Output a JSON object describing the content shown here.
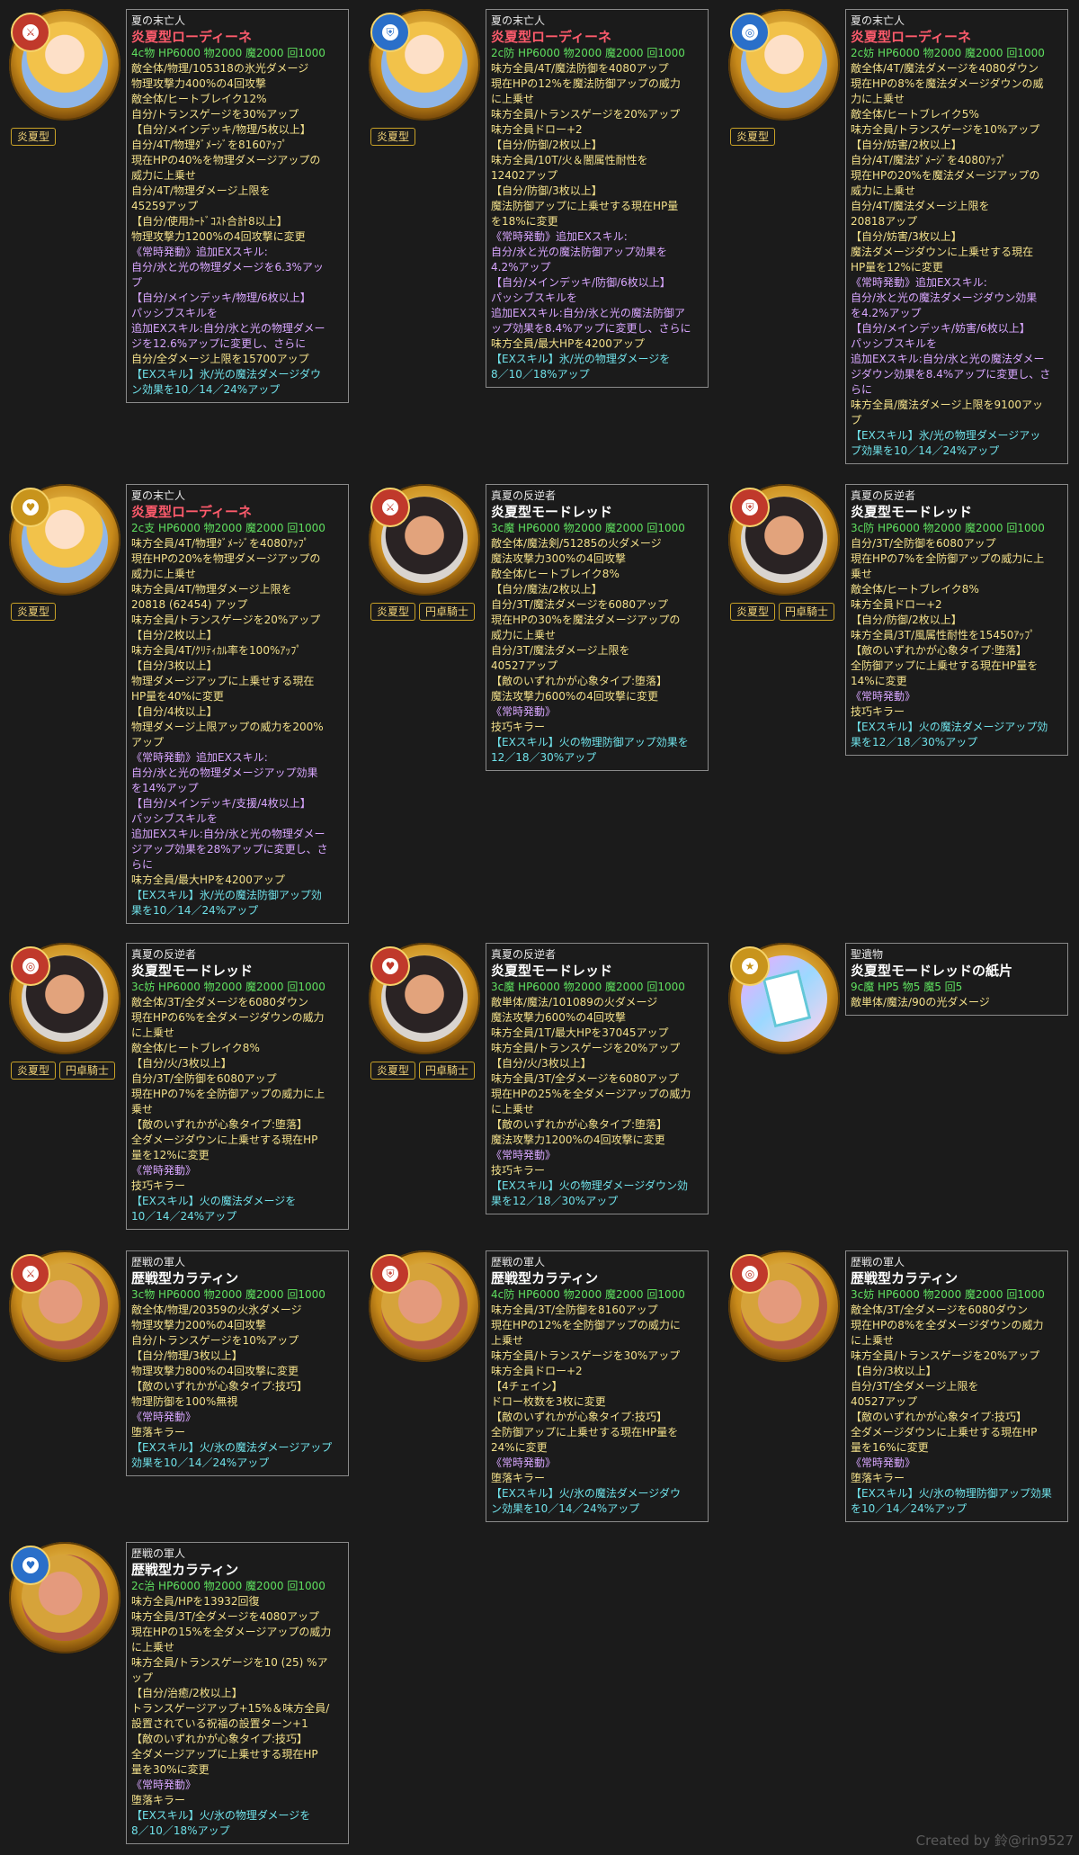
{
  "cards": [
    {
      "portrait": "roh",
      "badge": "sword-icon",
      "badge_color": "red",
      "tags": [
        "炎夏型"
      ],
      "subtitle": "夏の末亡人",
      "name": "炎夏型ローディーネ",
      "name_color": "red",
      "stats": "4c物 HP6000 物2000 魔2000 回1000",
      "lines": [
        {
          "c": "y",
          "t": "敵全体/物理/105318の氷光ダメージ"
        },
        {
          "c": "y",
          "t": "物理攻撃力400%の4回攻撃"
        },
        {
          "c": "y",
          "t": "敵全体/ヒートブレイク12%"
        },
        {
          "c": "y",
          "t": "自分/トランスゲージを30%アップ"
        },
        {
          "c": "y",
          "t": "【自分/メインデッキ/物理/5枚以上】"
        },
        {
          "c": "y",
          "t": "自分/4T/物理ﾀﾞﾒｰｼﾞを8160ｱｯﾌﾟ"
        },
        {
          "c": "y",
          "t": "現在HPの40%を物理ダメージアップの"
        },
        {
          "c": "y",
          "t": "威力に上乗せ"
        },
        {
          "c": "y",
          "t": "自分/4T/物理ダメージ上限を"
        },
        {
          "c": "y",
          "t": "45259アップ"
        },
        {
          "c": "y",
          "t": "【自分/使用ｶｰﾄﾞｺｽﾄ合計8以上】"
        },
        {
          "c": "y",
          "t": "物理攻撃力1200%の4回攻撃に変更"
        },
        {
          "c": "p",
          "t": "《常時発動》追加EXスキル:"
        },
        {
          "c": "p",
          "t": "自分/氷と光の物理ダメージを6.3%アッ"
        },
        {
          "c": "p",
          "t": "プ"
        },
        {
          "c": "p",
          "t": "【自分/メインデッキ/物理/6枚以上】"
        },
        {
          "c": "p",
          "t": "パッシブスキルを"
        },
        {
          "c": "p",
          "t": "追加EXスキル:自分/氷と光の物理ダメー"
        },
        {
          "c": "p",
          "t": "ジを12.6%アップに変更し、さらに"
        },
        {
          "c": "y",
          "t": "自分/全ダメージ上限を15700アップ"
        },
        {
          "c": "c",
          "t": "【EXスキル】氷/光の魔法ダメージダウ"
        },
        {
          "c": "c",
          "t": "ン効果を10／14／24%アップ"
        }
      ]
    },
    {
      "portrait": "roh",
      "badge": "shield-icon",
      "badge_color": "blue",
      "tags": [
        "炎夏型"
      ],
      "subtitle": "夏の末亡人",
      "name": "炎夏型ローディーネ",
      "name_color": "red",
      "stats": "2c防 HP6000 物2000 魔2000 回1000",
      "lines": [
        {
          "c": "y",
          "t": "味方全員/4T/魔法防御を4080アップ"
        },
        {
          "c": "y",
          "t": "現在HPの12%を魔法防御アップの威力"
        },
        {
          "c": "y",
          "t": "に上乗せ"
        },
        {
          "c": "y",
          "t": "味方全員/トランスゲージを20%アップ"
        },
        {
          "c": "y",
          "t": "味方全員ドロー+2"
        },
        {
          "c": "y",
          "t": "【自分/防御/2枚以上】"
        },
        {
          "c": "y",
          "t": "味方全員/10T/火＆闇属性耐性を"
        },
        {
          "c": "y",
          "t": "12402アップ"
        },
        {
          "c": "y",
          "t": "【自分/防御/3枚以上】"
        },
        {
          "c": "y",
          "t": "魔法防御アップに上乗せする現在HP量"
        },
        {
          "c": "y",
          "t": "を18%に変更"
        },
        {
          "c": "p",
          "t": "《常時発動》追加EXスキル:"
        },
        {
          "c": "p",
          "t": "自分/氷と光の魔法防御アップ効果を"
        },
        {
          "c": "p",
          "t": "4.2%アップ"
        },
        {
          "c": "p",
          "t": "【自分/メインデッキ/防御/6枚以上】"
        },
        {
          "c": "p",
          "t": "パッシブスキルを"
        },
        {
          "c": "p",
          "t": "追加EXスキル:自分/氷と光の魔法防御ア"
        },
        {
          "c": "p",
          "t": "ップ効果を8.4%アップに変更し、さらに"
        },
        {
          "c": "y",
          "t": "味方全員/最大HPを4200アップ"
        },
        {
          "c": "c",
          "t": "【EXスキル】氷/光の物理ダメージを"
        },
        {
          "c": "c",
          "t": "8／10／18%アップ"
        }
      ]
    },
    {
      "portrait": "roh",
      "badge": "swirl-icon",
      "badge_color": "blue",
      "tags": [
        "炎夏型"
      ],
      "subtitle": "夏の末亡人",
      "name": "炎夏型ローディーネ",
      "name_color": "red",
      "stats": "2c妨 HP6000 物2000 魔2000 回1000",
      "lines": [
        {
          "c": "y",
          "t": "敵全体/4T/魔法ダメージを4080ダウン"
        },
        {
          "c": "y",
          "t": "現在HPの8%を魔法ダメージダウンの威"
        },
        {
          "c": "y",
          "t": "力に上乗せ"
        },
        {
          "c": "y",
          "t": "敵全体/ヒートブレイク5%"
        },
        {
          "c": "y",
          "t": "味方全員/トランスゲージを10%アップ"
        },
        {
          "c": "y",
          "t": "【自分/妨害/2枚以上】"
        },
        {
          "c": "y",
          "t": "自分/4T/魔法ﾀﾞﾒｰｼﾞを4080ｱｯﾌﾟ"
        },
        {
          "c": "y",
          "t": "現在HPの20%を魔法ダメージアップの"
        },
        {
          "c": "y",
          "t": "威力に上乗せ"
        },
        {
          "c": "y",
          "t": "自分/4T/魔法ダメージ上限を"
        },
        {
          "c": "y",
          "t": "20818アップ"
        },
        {
          "c": "y",
          "t": "【自分/妨害/3枚以上】"
        },
        {
          "c": "y",
          "t": "魔法ダメージダウンに上乗せする現在"
        },
        {
          "c": "y",
          "t": "HP量を12%に変更"
        },
        {
          "c": "p",
          "t": "《常時発動》追加EXスキル:"
        },
        {
          "c": "p",
          "t": "自分/氷と光の魔法ダメージダウン効果"
        },
        {
          "c": "p",
          "t": "を4.2%アップ"
        },
        {
          "c": "p",
          "t": "【自分/メインデッキ/妨害/6枚以上】"
        },
        {
          "c": "p",
          "t": "パッシブスキルを"
        },
        {
          "c": "p",
          "t": "追加EXスキル:自分/氷と光の魔法ダメー"
        },
        {
          "c": "p",
          "t": "ジダウン効果を8.4%アップに変更し、さ"
        },
        {
          "c": "p",
          "t": "らに"
        },
        {
          "c": "y",
          "t": "味方全員/魔法ダメージ上限を9100アッ"
        },
        {
          "c": "y",
          "t": "プ"
        },
        {
          "c": "c",
          "t": "【EXスキル】氷/光の物理ダメージアッ"
        },
        {
          "c": "c",
          "t": "プ効果を10／14／24%アップ"
        }
      ]
    },
    {
      "portrait": "roh",
      "badge": "heart-icon",
      "badge_color": "gold",
      "tags": [
        "炎夏型"
      ],
      "subtitle": "夏の末亡人",
      "name": "炎夏型ローディーネ",
      "name_color": "red",
      "stats": "2c支 HP6000 物2000 魔2000 回1000",
      "lines": [
        {
          "c": "y",
          "t": "味方全員/4T/物理ﾀﾞﾒｰｼﾞを4080ｱｯﾌﾟ"
        },
        {
          "c": "y",
          "t": "現在HPの20%を物理ダメージアップの"
        },
        {
          "c": "y",
          "t": "威力に上乗せ"
        },
        {
          "c": "y",
          "t": "味方全員/4T/物理ダメージ上限を"
        },
        {
          "c": "y",
          "t": "20818 (62454) アップ"
        },
        {
          "c": "y",
          "t": "味方全員/トランスゲージを20%アップ"
        },
        {
          "c": "y",
          "t": "【自分/2枚以上】"
        },
        {
          "c": "y",
          "t": "味方全員/4T/ｸﾘﾃｨｶﾙ率を100%ｱｯﾌﾟ"
        },
        {
          "c": "y",
          "t": "【自分/3枚以上】"
        },
        {
          "c": "y",
          "t": "物理ダメージアップに上乗せする現在"
        },
        {
          "c": "y",
          "t": "HP量を40%に変更"
        },
        {
          "c": "y",
          "t": "【自分/4枚以上】"
        },
        {
          "c": "y",
          "t": "物理ダメージ上限アップの威力を200%"
        },
        {
          "c": "y",
          "t": "アップ"
        },
        {
          "c": "p",
          "t": "《常時発動》追加EXスキル:"
        },
        {
          "c": "p",
          "t": "自分/氷と光の物理ダメージアップ効果"
        },
        {
          "c": "p",
          "t": "を14%アップ"
        },
        {
          "c": "p",
          "t": "【自分/メインデッキ/支援/4枚以上】"
        },
        {
          "c": "p",
          "t": "パッシブスキルを"
        },
        {
          "c": "p",
          "t": "追加EXスキル:自分/氷と光の物理ダメー"
        },
        {
          "c": "p",
          "t": "ジアップ効果を28%アップに変更し、さ"
        },
        {
          "c": "p",
          "t": "らに"
        },
        {
          "c": "y",
          "t": "味方全員/最大HPを4200アップ"
        },
        {
          "c": "c",
          "t": "【EXスキル】氷/光の魔法防御アップ効"
        },
        {
          "c": "c",
          "t": "果を10／14／24%アップ"
        }
      ]
    },
    {
      "portrait": "mor",
      "badge": "sword-icon",
      "badge_color": "red",
      "tags": [
        "炎夏型",
        "円卓騎士"
      ],
      "subtitle": "真夏の反逆者",
      "name": "炎夏型モードレッド",
      "name_color": "white",
      "stats": "3c魔 HP6000 物2000 魔2000 回1000",
      "lines": [
        {
          "c": "y",
          "t": "敵全体/魔法剣/51285の火ダメージ"
        },
        {
          "c": "y",
          "t": "魔法攻撃力300%の4回攻撃"
        },
        {
          "c": "y",
          "t": "敵全体/ヒートブレイク8%"
        },
        {
          "c": "y",
          "t": "【自分/魔法/2枚以上】"
        },
        {
          "c": "y",
          "t": "自分/3T/魔法ダメージを6080アップ"
        },
        {
          "c": "y",
          "t": "現在HPの30%を魔法ダメージアップの"
        },
        {
          "c": "y",
          "t": "威力に上乗せ"
        },
        {
          "c": "y",
          "t": "自分/3T/魔法ダメージ上限を"
        },
        {
          "c": "y",
          "t": "40527アップ"
        },
        {
          "c": "y",
          "t": "【敵のいずれかが心象タイプ:堕落】"
        },
        {
          "c": "y",
          "t": "魔法攻撃力600%の4回攻撃に変更"
        },
        {
          "c": "p",
          "t": "《常時発動》"
        },
        {
          "c": "y",
          "t": "技巧キラー"
        },
        {
          "c": "c",
          "t": "【EXスキル】火の物理防御アップ効果を"
        },
        {
          "c": "c",
          "t": "12／18／30%アップ"
        }
      ]
    },
    {
      "portrait": "mor",
      "badge": "shield-icon",
      "badge_color": "red",
      "tags": [
        "炎夏型",
        "円卓騎士"
      ],
      "subtitle": "真夏の反逆者",
      "name": "炎夏型モードレッド",
      "name_color": "white",
      "stats": "3c防 HP6000 物2000 魔2000 回1000",
      "lines": [
        {
          "c": "y",
          "t": "自分/3T/全防御を6080アップ"
        },
        {
          "c": "y",
          "t": "現在HPの7%を全防御アップの威力に上"
        },
        {
          "c": "y",
          "t": "乗せ"
        },
        {
          "c": "y",
          "t": "敵全体/ヒートブレイク8%"
        },
        {
          "c": "y",
          "t": "味方全員ドロー+2"
        },
        {
          "c": "y",
          "t": "【自分/防御/2枚以上】"
        },
        {
          "c": "y",
          "t": "味方全員/3T/風属性耐性を15450ｱｯﾌﾟ"
        },
        {
          "c": "y",
          "t": "【敵のいずれかが心象タイプ:堕落】"
        },
        {
          "c": "y",
          "t": "全防御アップに上乗せする現在HP量を"
        },
        {
          "c": "y",
          "t": "14%に変更"
        },
        {
          "c": "p",
          "t": "《常時発動》"
        },
        {
          "c": "y",
          "t": "技巧キラー"
        },
        {
          "c": "c",
          "t": "【EXスキル】火の魔法ダメージアップ効"
        },
        {
          "c": "c",
          "t": "果を12／18／30%アップ"
        }
      ]
    },
    {
      "portrait": "mor",
      "badge": "swirl-icon",
      "badge_color": "red",
      "tags": [
        "炎夏型",
        "円卓騎士"
      ],
      "subtitle": "真夏の反逆者",
      "name": "炎夏型モードレッド",
      "name_color": "white",
      "stats": "3c妨 HP6000 物2000 魔2000 回1000",
      "lines": [
        {
          "c": "y",
          "t": "敵全体/3T/全ダメージを6080ダウン"
        },
        {
          "c": "y",
          "t": "現在HPの6%を全ダメージダウンの威力"
        },
        {
          "c": "y",
          "t": "に上乗せ"
        },
        {
          "c": "y",
          "t": "敵全体/ヒートブレイク8%"
        },
        {
          "c": "y",
          "t": "【自分/火/3枚以上】"
        },
        {
          "c": "y",
          "t": "自分/3T/全防御を6080アップ"
        },
        {
          "c": "y",
          "t": "現在HPの7%を全防御アップの威力に上"
        },
        {
          "c": "y",
          "t": "乗せ"
        },
        {
          "c": "y",
          "t": "【敵のいずれかが心象タイプ:堕落】"
        },
        {
          "c": "y",
          "t": "全ダメージダウンに上乗せする現在HP"
        },
        {
          "c": "y",
          "t": "量を12%に変更"
        },
        {
          "c": "p",
          "t": "《常時発動》"
        },
        {
          "c": "y",
          "t": "技巧キラー"
        },
        {
          "c": "c",
          "t": "【EXスキル】火の魔法ダメージを"
        },
        {
          "c": "c",
          "t": "10／14／24%アップ"
        }
      ]
    },
    {
      "portrait": "mor",
      "badge": "heart-icon",
      "badge_color": "red",
      "tags": [
        "炎夏型",
        "円卓騎士"
      ],
      "subtitle": "真夏の反逆者",
      "name": "炎夏型モードレッド",
      "name_color": "white",
      "stats": "3c魔 HP6000 物2000 魔2000 回1000",
      "lines": [
        {
          "c": "y",
          "t": "敵単体/魔法/101089の火ダメージ"
        },
        {
          "c": "y",
          "t": "魔法攻撃力600%の4回攻撃"
        },
        {
          "c": "y",
          "t": "味方全員/1T/最大HPを37045アップ"
        },
        {
          "c": "y",
          "t": "味方全員/トランスゲージを20%アップ"
        },
        {
          "c": "y",
          "t": "【自分/火/3枚以上】"
        },
        {
          "c": "y",
          "t": "味方全員/3T/全ダメージを6080アップ"
        },
        {
          "c": "y",
          "t": "現在HPの25%を全ダメージアップの威力"
        },
        {
          "c": "y",
          "t": "に上乗せ"
        },
        {
          "c": "y",
          "t": "【敵のいずれかが心象タイプ:堕落】"
        },
        {
          "c": "y",
          "t": "魔法攻撃力1200%の4回攻撃に変更"
        },
        {
          "c": "p",
          "t": "《常時発動》"
        },
        {
          "c": "y",
          "t": "技巧キラー"
        },
        {
          "c": "c",
          "t": "【EXスキル】火の物理ダメージダウン効"
        },
        {
          "c": "c",
          "t": "果を12／18／30%アップ"
        }
      ]
    },
    {
      "portrait": "paper",
      "badge": "star-icon",
      "badge_color": "gold",
      "tags": [],
      "subtitle": "聖遺物",
      "name": "炎夏型モードレッドの紙片",
      "name_color": "white",
      "stats": "9c魔 HP5 物5 魔5 回5",
      "lines": [
        {
          "c": "y",
          "t": "敵単体/魔法/90の光ダメージ"
        },
        {
          "c": "y",
          "t": " "
        },
        {
          "c": "y",
          "t": " "
        }
      ]
    },
    {
      "portrait": "kar",
      "badge": "sword-icon",
      "badge_color": "red",
      "tags": [],
      "subtitle": "歴戦の軍人",
      "name": "歴戦型カラティン",
      "name_color": "white",
      "stats": "3c物 HP6000 物2000 魔2000 回1000",
      "lines": [
        {
          "c": "y",
          "t": "敵全体/物理/20359の火氷ダメージ"
        },
        {
          "c": "y",
          "t": "物理攻撃力200%の4回攻撃"
        },
        {
          "c": "y",
          "t": "自分/トランスゲージを10%アップ"
        },
        {
          "c": "y",
          "t": "【自分/物理/3枚以上】"
        },
        {
          "c": "y",
          "t": "物理攻撃力800%の4回攻撃に変更"
        },
        {
          "c": "y",
          "t": "【敵のいずれかが心象タイプ:技巧】"
        },
        {
          "c": "y",
          "t": "物理防御を100%無視"
        },
        {
          "c": "p",
          "t": "《常時発動》"
        },
        {
          "c": "y",
          "t": "堕落キラー"
        },
        {
          "c": "c",
          "t": "【EXスキル】火/氷の魔法ダメージアップ"
        },
        {
          "c": "c",
          "t": "効果を10／14／24%アップ"
        }
      ]
    },
    {
      "portrait": "kar",
      "badge": "shield-icon",
      "badge_color": "red",
      "tags": [],
      "subtitle": "歴戦の軍人",
      "name": "歴戦型カラティン",
      "name_color": "white",
      "stats": "4c防 HP6000 物2000 魔2000 回1000",
      "lines": [
        {
          "c": "y",
          "t": "味方全員/3T/全防御を8160アップ"
        },
        {
          "c": "y",
          "t": "現在HPの12%を全防御アップの威力に"
        },
        {
          "c": "y",
          "t": "上乗せ"
        },
        {
          "c": "y",
          "t": "味方全員/トランスゲージを30%アップ"
        },
        {
          "c": "y",
          "t": "味方全員ドロー+2"
        },
        {
          "c": "y",
          "t": "【4チェイン】"
        },
        {
          "c": "y",
          "t": "ドロー枚数を3枚に変更"
        },
        {
          "c": "y",
          "t": "【敵のいずれかが心象タイプ:技巧】"
        },
        {
          "c": "y",
          "t": "全防御アップに上乗せする現在HP量を"
        },
        {
          "c": "y",
          "t": "24%に変更"
        },
        {
          "c": "p",
          "t": "《常時発動》"
        },
        {
          "c": "y",
          "t": "堕落キラー"
        },
        {
          "c": "c",
          "t": "【EXスキル】火/氷の魔法ダメージダウ"
        },
        {
          "c": "c",
          "t": "ン効果を10／14／24%アップ"
        }
      ]
    },
    {
      "portrait": "kar",
      "badge": "swirl-icon",
      "badge_color": "red",
      "tags": [],
      "subtitle": "歴戦の軍人",
      "name": "歴戦型カラティン",
      "name_color": "white",
      "stats": "3c妨 HP6000 物2000 魔2000 回1000",
      "lines": [
        {
          "c": "y",
          "t": "敵全体/3T/全ダメージを6080ダウン"
        },
        {
          "c": "y",
          "t": "現在HPの8%を全ダメージダウンの威力"
        },
        {
          "c": "y",
          "t": "に上乗せ"
        },
        {
          "c": "y",
          "t": "味方全員/トランスゲージを20%アップ"
        },
        {
          "c": "y",
          "t": "【自分/3枚以上】"
        },
        {
          "c": "y",
          "t": "自分/3T/全ダメージ上限を"
        },
        {
          "c": "y",
          "t": "40527アップ"
        },
        {
          "c": "y",
          "t": "【敵のいずれかが心象タイプ:技巧】"
        },
        {
          "c": "y",
          "t": "全ダメージダウンに上乗せする現在HP"
        },
        {
          "c": "y",
          "t": "量を16%に変更"
        },
        {
          "c": "p",
          "t": "《常時発動》"
        },
        {
          "c": "y",
          "t": "堕落キラー"
        },
        {
          "c": "c",
          "t": "【EXスキル】火/氷の物理防御アップ効果"
        },
        {
          "c": "c",
          "t": "を10／14／24%アップ"
        }
      ]
    },
    {
      "portrait": "kar",
      "badge": "heart-icon",
      "badge_color": "blue",
      "tags": [],
      "subtitle": "歴戦の軍人",
      "name": "歴戦型カラティン",
      "name_color": "white",
      "stats": "2c治 HP6000 物2000 魔2000 回1000",
      "lines": [
        {
          "c": "y",
          "t": "味方全員/HPを13932回復"
        },
        {
          "c": "y",
          "t": "味方全員/3T/全ダメージを4080アップ"
        },
        {
          "c": "y",
          "t": "現在HPの15%を全ダメージアップの威力"
        },
        {
          "c": "y",
          "t": "に上乗せ"
        },
        {
          "c": "y",
          "t": "味方全員/トランスゲージを10 (25) %ア"
        },
        {
          "c": "y",
          "t": "ップ"
        },
        {
          "c": "y",
          "t": "【自分/治癒/2枚以上】"
        },
        {
          "c": "y",
          "t": "トランスゲージアップ+15%＆味方全員/"
        },
        {
          "c": "y",
          "t": "設置されている祝福の設置ターン+1"
        },
        {
          "c": "y",
          "t": "【敵のいずれかが心象タイプ:技巧】"
        },
        {
          "c": "y",
          "t": "全ダメージアップに上乗せする現在HP"
        },
        {
          "c": "y",
          "t": "量を30%に変更"
        },
        {
          "c": "p",
          "t": "《常時発動》"
        },
        {
          "c": "y",
          "t": "堕落キラー"
        },
        {
          "c": "c",
          "t": "【EXスキル】火/氷の物理ダメージを"
        },
        {
          "c": "c",
          "t": "8／10／18%アップ"
        }
      ]
    }
  ],
  "credit": "Created by 鈴@rin9527"
}
